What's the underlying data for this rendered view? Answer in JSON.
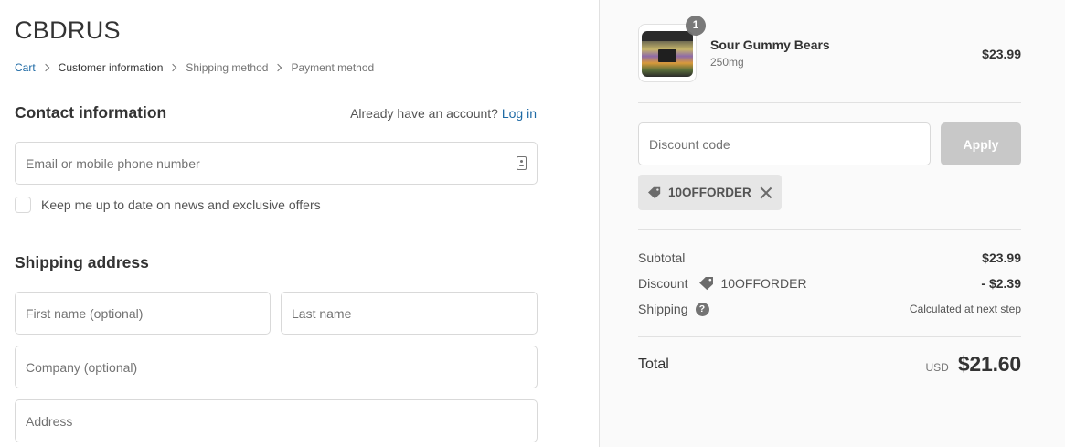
{
  "store": {
    "name": "CBDRUS"
  },
  "breadcrumb": {
    "items": [
      {
        "label": "Cart"
      },
      {
        "label": "Customer information"
      },
      {
        "label": "Shipping method"
      },
      {
        "label": "Payment method"
      }
    ]
  },
  "contact": {
    "title": "Contact information",
    "account_prompt": "Already have an account?",
    "login_label": "Log in",
    "email_placeholder": "Email or mobile phone number",
    "email_value": "",
    "newsletter_label": "Keep me up to date on news and exclusive offers",
    "newsletter_checked": false
  },
  "shipping": {
    "title": "Shipping address",
    "first_name_placeholder": "First name (optional)",
    "last_name_placeholder": "Last name",
    "company_placeholder": "Company (optional)",
    "address_placeholder": "Address"
  },
  "order": {
    "item": {
      "name": "Sour Gummy Bears",
      "variant": "250mg",
      "price": "$23.99",
      "quantity": "1"
    },
    "discount_placeholder": "Discount code",
    "apply_label": "Apply",
    "applied_code": "10OFFORDER",
    "subtotal_label": "Subtotal",
    "subtotal_value": "$23.99",
    "discount_label": "Discount",
    "discount_code": "10OFFORDER",
    "discount_value": "- $2.39",
    "shipping_label": "Shipping",
    "shipping_value": "Calculated at next step",
    "total_label": "Total",
    "currency": "USD",
    "total_value": "$21.60"
  },
  "colors": {
    "link": "#1e6aa5",
    "sidebar_bg": "#fafafa",
    "button_disabled": "#c8c8c8"
  }
}
